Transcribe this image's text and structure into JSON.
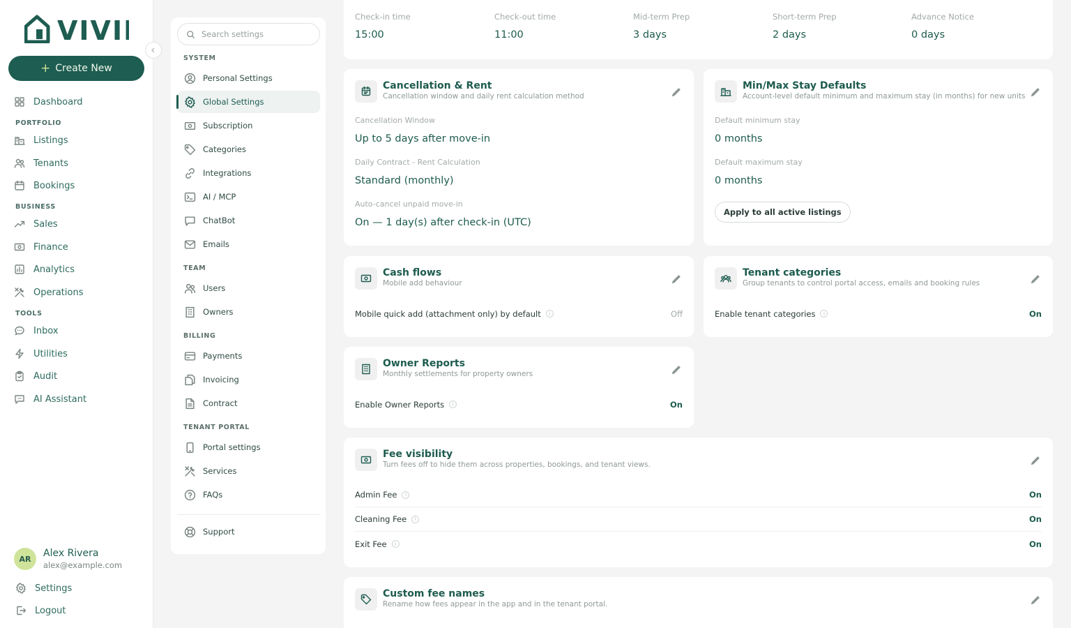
{
  "brand": {
    "name": "VIVIN"
  },
  "nav": {
    "create_label": "Create New",
    "dashboard": "Dashboard",
    "portfolio_heading": "PORTFOLIO",
    "listings": "Listings",
    "tenants": "Tenants",
    "bookings": "Bookings",
    "business_heading": "BUSINESS",
    "sales": "Sales",
    "finance": "Finance",
    "analytics": "Analytics",
    "operations": "Operations",
    "tools_heading": "TOOLS",
    "inbox": "Inbox",
    "utilities": "Utilities",
    "audit": "Audit",
    "ai_assistant": "AI Assistant",
    "settings": "Settings",
    "logout": "Logout"
  },
  "user": {
    "initials": "AR",
    "name": "Alex Rivera",
    "email": "alex@example.com"
  },
  "settings_menu": {
    "search_placeholder": "Search settings",
    "system_heading": "SYSTEM",
    "personal": "Personal Settings",
    "global": "Global Settings",
    "subscription": "Subscription",
    "categories": "Categories",
    "integrations": "Integrations",
    "ai_mcp": "AI / MCP",
    "chatbot": "ChatBot",
    "emails": "Emails",
    "team_heading": "TEAM",
    "users": "Users",
    "owners": "Owners",
    "billing_heading": "BILLING",
    "payments": "Payments",
    "invoicing": "Invoicing",
    "contract": "Contract",
    "portal_heading": "TENANT PORTAL",
    "portal_settings": "Portal settings",
    "services": "Services",
    "faqs": "FAQs",
    "support": "Support"
  },
  "timing": {
    "checkin_label": "Check-in time",
    "checkin_value": "15:00",
    "checkout_label": "Check-out time",
    "checkout_value": "11:00",
    "midterm_label": "Mid-term Prep",
    "midterm_value": "3 days",
    "shortterm_label": "Short-term Prep",
    "shortterm_value": "2 days",
    "notice_label": "Advance Notice",
    "notice_value": "0 days"
  },
  "cancellation": {
    "title": "Cancellation & Rent",
    "subtitle": "Cancellation window and daily rent calculation method",
    "window_label": "Cancellation Window",
    "window_value": "Up to 5 days after move-in",
    "rent_label": "Daily Contract - Rent Calculation",
    "rent_value": "Standard (monthly)",
    "autocancel_label": "Auto-cancel unpaid move-in",
    "autocancel_value": "On — 1 day(s) after check-in (UTC)"
  },
  "stay": {
    "title": "Min/Max Stay Defaults",
    "subtitle": "Account-level default minimum and maximum stay (in months) for new units",
    "min_label": "Default minimum stay",
    "min_value": "0 months",
    "max_label": "Default maximum stay",
    "max_value": "0 months",
    "apply_label": "Apply to all active listings"
  },
  "cashflows": {
    "title": "Cash flows",
    "subtitle": "Mobile add behaviour",
    "row_label": "Mobile quick add (attachment only) by default",
    "row_value": "Off"
  },
  "tenant_categories": {
    "title": "Tenant categories",
    "subtitle": "Group tenants to control portal access, emails and booking rules",
    "row_label": "Enable tenant categories",
    "row_value": "On"
  },
  "owner_reports": {
    "title": "Owner Reports",
    "subtitle": "Monthly settlements for property owners",
    "row_label": "Enable Owner Reports",
    "row_value": "On"
  },
  "fees": {
    "title": "Fee visibility",
    "subtitle": "Turn fees off to hide them across properties, bookings, and tenant views.",
    "admin_label": "Admin Fee",
    "admin_value": "On",
    "cleaning_label": "Cleaning Fee",
    "cleaning_value": "On",
    "exit_label": "Exit Fee",
    "exit_value": "On"
  },
  "custom_fees": {
    "title": "Custom fee names",
    "subtitle": "Rename how fees appear in the app and in the tenant portal."
  },
  "colors": {
    "brand": "#1e5d51",
    "avatar": "#cfe39a",
    "background": "#f4f4f4"
  }
}
